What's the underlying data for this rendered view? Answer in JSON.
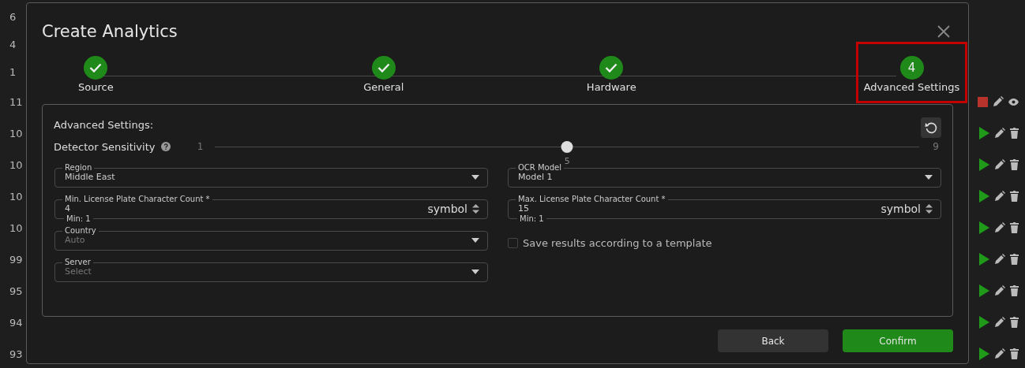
{
  "background_rows": [
    {
      "number": "6"
    },
    {
      "number": "4"
    },
    {
      "number": "1"
    },
    {
      "number": "11",
      "kind": "stopped"
    },
    {
      "number": "10",
      "kind": "running"
    },
    {
      "number": "10",
      "kind": "running"
    },
    {
      "number": "10",
      "kind": "running"
    },
    {
      "number": "10",
      "kind": "running"
    },
    {
      "number": "99",
      "kind": "running"
    },
    {
      "number": "95",
      "kind": "running"
    },
    {
      "number": "94",
      "kind": "running"
    },
    {
      "number": "93",
      "kind": "running"
    }
  ],
  "dialog": {
    "title": "Create Analytics",
    "steps": [
      {
        "label": "Source",
        "completed": true,
        "highlighted": false
      },
      {
        "label": "General",
        "completed": true,
        "highlighted": false
      },
      {
        "label": "Hardware",
        "completed": true,
        "highlighted": false
      },
      {
        "label": "Advanced Settings",
        "number": "4",
        "completed": false,
        "highlighted": true
      }
    ],
    "section_title": "Advanced Settings:",
    "sensitivity": {
      "label": "Detector Sensitivity",
      "min": "1",
      "max": "9",
      "reading": "5",
      "level": 0.5
    },
    "left_fields": [
      {
        "kind": "select",
        "label": "Region",
        "value": "Middle East"
      },
      {
        "kind": "number",
        "label": "Min. License Plate Character Count *",
        "value": "4",
        "unit": "symbol",
        "helper": "Min: 1"
      },
      {
        "kind": "select",
        "label": "Country",
        "placeholder": "Auto"
      },
      {
        "kind": "select",
        "label": "Server",
        "placeholder": "Select"
      }
    ],
    "right_fields": [
      {
        "kind": "select",
        "label": "OCR Model",
        "value": "Model 1"
      },
      {
        "kind": "number",
        "label": "Max. License Plate Character Count *",
        "value": "15",
        "unit": "symbol",
        "helper": "Min: 1"
      },
      {
        "kind": "checkbox",
        "label": "Save results according to a template",
        "checked": false
      }
    ],
    "buttons": [
      {
        "kind": "secondary",
        "label": "Back"
      },
      {
        "kind": "primary",
        "label": "Confirm"
      }
    ]
  }
}
